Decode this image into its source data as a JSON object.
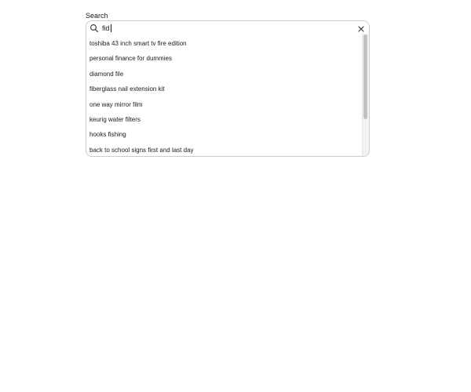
{
  "search": {
    "label": "Search",
    "query": "fid",
    "icons": {
      "search": "search-icon",
      "clear": "close-icon"
    },
    "suggestions": [
      "toshiba 43 inch smart tv fire edition",
      "personal finance for dummies",
      "diamond file",
      "fiberglass nail extension kit",
      "one way mirror film",
      "keurig water filters",
      "hooks fishing",
      "back to school signs first and last day"
    ]
  }
}
